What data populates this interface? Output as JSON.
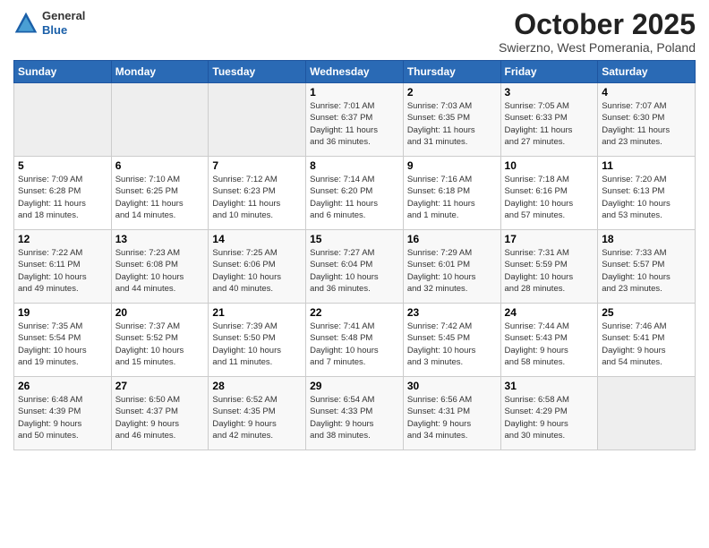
{
  "logo": {
    "general": "General",
    "blue": "Blue"
  },
  "title": "October 2025",
  "subtitle": "Swierzno, West Pomerania, Poland",
  "headers": [
    "Sunday",
    "Monday",
    "Tuesday",
    "Wednesday",
    "Thursday",
    "Friday",
    "Saturday"
  ],
  "weeks": [
    [
      {
        "num": "",
        "info": ""
      },
      {
        "num": "",
        "info": ""
      },
      {
        "num": "",
        "info": ""
      },
      {
        "num": "1",
        "info": "Sunrise: 7:01 AM\nSunset: 6:37 PM\nDaylight: 11 hours\nand 36 minutes."
      },
      {
        "num": "2",
        "info": "Sunrise: 7:03 AM\nSunset: 6:35 PM\nDaylight: 11 hours\nand 31 minutes."
      },
      {
        "num": "3",
        "info": "Sunrise: 7:05 AM\nSunset: 6:33 PM\nDaylight: 11 hours\nand 27 minutes."
      },
      {
        "num": "4",
        "info": "Sunrise: 7:07 AM\nSunset: 6:30 PM\nDaylight: 11 hours\nand 23 minutes."
      }
    ],
    [
      {
        "num": "5",
        "info": "Sunrise: 7:09 AM\nSunset: 6:28 PM\nDaylight: 11 hours\nand 18 minutes."
      },
      {
        "num": "6",
        "info": "Sunrise: 7:10 AM\nSunset: 6:25 PM\nDaylight: 11 hours\nand 14 minutes."
      },
      {
        "num": "7",
        "info": "Sunrise: 7:12 AM\nSunset: 6:23 PM\nDaylight: 11 hours\nand 10 minutes."
      },
      {
        "num": "8",
        "info": "Sunrise: 7:14 AM\nSunset: 6:20 PM\nDaylight: 11 hours\nand 6 minutes."
      },
      {
        "num": "9",
        "info": "Sunrise: 7:16 AM\nSunset: 6:18 PM\nDaylight: 11 hours\nand 1 minute."
      },
      {
        "num": "10",
        "info": "Sunrise: 7:18 AM\nSunset: 6:16 PM\nDaylight: 10 hours\nand 57 minutes."
      },
      {
        "num": "11",
        "info": "Sunrise: 7:20 AM\nSunset: 6:13 PM\nDaylight: 10 hours\nand 53 minutes."
      }
    ],
    [
      {
        "num": "12",
        "info": "Sunrise: 7:22 AM\nSunset: 6:11 PM\nDaylight: 10 hours\nand 49 minutes."
      },
      {
        "num": "13",
        "info": "Sunrise: 7:23 AM\nSunset: 6:08 PM\nDaylight: 10 hours\nand 44 minutes."
      },
      {
        "num": "14",
        "info": "Sunrise: 7:25 AM\nSunset: 6:06 PM\nDaylight: 10 hours\nand 40 minutes."
      },
      {
        "num": "15",
        "info": "Sunrise: 7:27 AM\nSunset: 6:04 PM\nDaylight: 10 hours\nand 36 minutes."
      },
      {
        "num": "16",
        "info": "Sunrise: 7:29 AM\nSunset: 6:01 PM\nDaylight: 10 hours\nand 32 minutes."
      },
      {
        "num": "17",
        "info": "Sunrise: 7:31 AM\nSunset: 5:59 PM\nDaylight: 10 hours\nand 28 minutes."
      },
      {
        "num": "18",
        "info": "Sunrise: 7:33 AM\nSunset: 5:57 PM\nDaylight: 10 hours\nand 23 minutes."
      }
    ],
    [
      {
        "num": "19",
        "info": "Sunrise: 7:35 AM\nSunset: 5:54 PM\nDaylight: 10 hours\nand 19 minutes."
      },
      {
        "num": "20",
        "info": "Sunrise: 7:37 AM\nSunset: 5:52 PM\nDaylight: 10 hours\nand 15 minutes."
      },
      {
        "num": "21",
        "info": "Sunrise: 7:39 AM\nSunset: 5:50 PM\nDaylight: 10 hours\nand 11 minutes."
      },
      {
        "num": "22",
        "info": "Sunrise: 7:41 AM\nSunset: 5:48 PM\nDaylight: 10 hours\nand 7 minutes."
      },
      {
        "num": "23",
        "info": "Sunrise: 7:42 AM\nSunset: 5:45 PM\nDaylight: 10 hours\nand 3 minutes."
      },
      {
        "num": "24",
        "info": "Sunrise: 7:44 AM\nSunset: 5:43 PM\nDaylight: 9 hours\nand 58 minutes."
      },
      {
        "num": "25",
        "info": "Sunrise: 7:46 AM\nSunset: 5:41 PM\nDaylight: 9 hours\nand 54 minutes."
      }
    ],
    [
      {
        "num": "26",
        "info": "Sunrise: 6:48 AM\nSunset: 4:39 PM\nDaylight: 9 hours\nand 50 minutes."
      },
      {
        "num": "27",
        "info": "Sunrise: 6:50 AM\nSunset: 4:37 PM\nDaylight: 9 hours\nand 46 minutes."
      },
      {
        "num": "28",
        "info": "Sunrise: 6:52 AM\nSunset: 4:35 PM\nDaylight: 9 hours\nand 42 minutes."
      },
      {
        "num": "29",
        "info": "Sunrise: 6:54 AM\nSunset: 4:33 PM\nDaylight: 9 hours\nand 38 minutes."
      },
      {
        "num": "30",
        "info": "Sunrise: 6:56 AM\nSunset: 4:31 PM\nDaylight: 9 hours\nand 34 minutes."
      },
      {
        "num": "31",
        "info": "Sunrise: 6:58 AM\nSunset: 4:29 PM\nDaylight: 9 hours\nand 30 minutes."
      },
      {
        "num": "",
        "info": ""
      }
    ]
  ]
}
